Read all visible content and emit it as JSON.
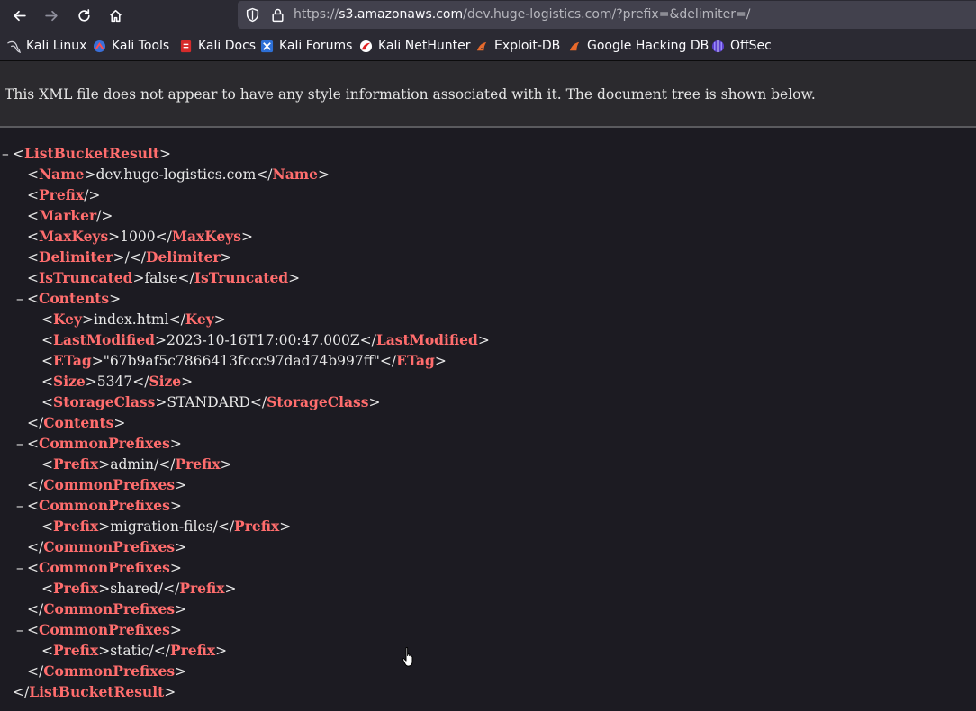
{
  "browser": {
    "url_scheme": "https://",
    "url_host": "s3.amazonaws.com",
    "url_rest": "/dev.huge-logistics.com/?prefix=&delimiter=/"
  },
  "bookmarks": [
    {
      "label": "Kali Linux",
      "icon": "kali-dragon-icon"
    },
    {
      "label": "Kali Tools",
      "icon": "kali-tools-icon"
    },
    {
      "label": "Kali Docs",
      "icon": "kali-docs-icon"
    },
    {
      "label": "Kali Forums",
      "icon": "kali-forums-icon"
    },
    {
      "label": "Kali NetHunter",
      "icon": "nethunter-icon"
    },
    {
      "label": "Exploit-DB",
      "icon": "exploit-db-icon"
    },
    {
      "label": "Google Hacking DB",
      "icon": "ghdb-icon"
    },
    {
      "label": "OffSec",
      "icon": "offsec-icon"
    }
  ],
  "xml_viewer": {
    "notice": "This XML file does not appear to have any style information associated with it. The document tree is shown below."
  },
  "tree": {
    "root": "ListBucketResult",
    "name_tag": "Name",
    "name": "dev.huge-logistics.com",
    "prefix_tag": "Prefix",
    "marker_tag": "Marker",
    "maxkeys_tag": "MaxKeys",
    "maxkeys": "1000",
    "delimiter_tag": "Delimiter",
    "delimiter": "/",
    "truncated_tag": "IsTruncated",
    "truncated": "false",
    "contents_tag": "Contents",
    "key_tag": "Key",
    "key": "index.html",
    "lastmod_tag": "LastModified",
    "lastmod": "2023-10-16T17:00:47.000Z",
    "etag_tag": "ETag",
    "etag": "\"67b9af5c7866413fccc97dad74b997ff\"",
    "size_tag": "Size",
    "size": "5347",
    "storage_tag": "StorageClass",
    "storage": "STANDARD",
    "common_tag": "CommonPrefixes",
    "prefixes": [
      "admin/",
      "migration-files/",
      "shared/",
      "static/"
    ],
    "toggle": "–"
  }
}
